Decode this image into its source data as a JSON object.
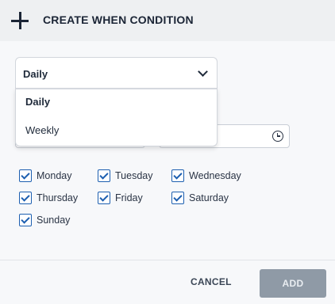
{
  "header": {
    "icon": "plus-icon",
    "title": "CREATE WHEN CONDITION"
  },
  "frequency": {
    "selected": "Daily",
    "options": [
      "Daily",
      "Weekly"
    ]
  },
  "time_field": {
    "icon": "clock-icon"
  },
  "days": [
    {
      "label": "Monday",
      "checked": true
    },
    {
      "label": "Tuesday",
      "checked": true
    },
    {
      "label": "Wednesday",
      "checked": true
    },
    {
      "label": "Thursday",
      "checked": true
    },
    {
      "label": "Friday",
      "checked": true
    },
    {
      "label": "Saturday",
      "checked": true
    },
    {
      "label": "Sunday",
      "checked": true
    }
  ],
  "footer": {
    "cancel_label": "CANCEL",
    "add_label": "ADD"
  },
  "colors": {
    "checkbox": "#1d5fb0",
    "add_button_disabled": "#8f9aa6"
  }
}
